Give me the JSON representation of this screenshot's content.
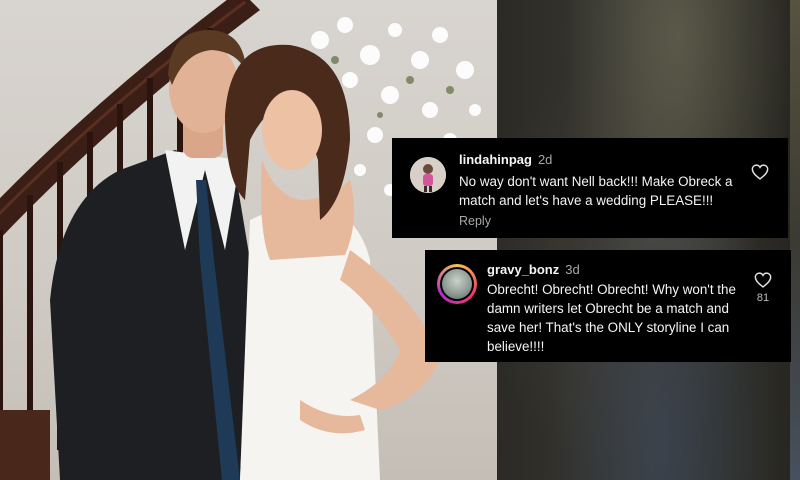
{
  "comments": [
    {
      "username": "lindahinpag",
      "time": "2d",
      "text": "No way don't want Nell back!!! Make Obreck a match and let's have a wedding PLEASE!!!",
      "reply_label": "Reply",
      "avatar_icon": "user-avatar-icon",
      "like_icon": "heart-icon"
    },
    {
      "username": "gravy_bonz",
      "time": "3d",
      "text": "Obrecht! Obrecht! Obrecht! Why won't the damn writers let Obrecht be a match and save her! That's the ONLY storyline I can believe!!!!",
      "like_count": "81",
      "avatar_icon": "story-ring-avatar-icon",
      "like_icon": "heart-icon"
    }
  ],
  "colors": {
    "card_background": "#000000",
    "text_primary": "#f5f5f5",
    "text_secondary": "#a8a8a8"
  }
}
